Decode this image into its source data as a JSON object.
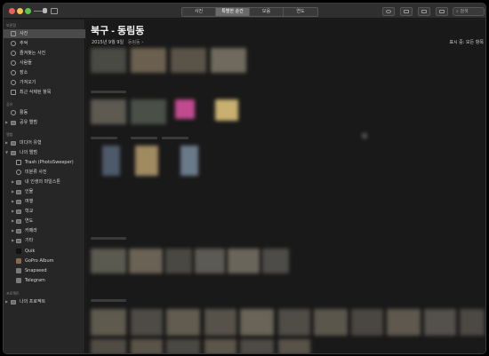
{
  "toolbar": {
    "tabs": [
      {
        "label": "사진"
      },
      {
        "label": "특별한 순간"
      },
      {
        "label": "모음"
      },
      {
        "label": "연도"
      }
    ],
    "active_tab": 1,
    "search_label": "검색"
  },
  "sidebar": {
    "library_label": "보관함",
    "shared_label": "공유",
    "albums_label": "앨범",
    "projects_label": "프로젝트",
    "library_items": [
      {
        "label": "사진"
      },
      {
        "label": "추억"
      },
      {
        "label": "즐겨찾는 사진"
      },
      {
        "label": "사람들"
      },
      {
        "label": "장소"
      },
      {
        "label": "가져오기"
      },
      {
        "label": "최근 삭제된 항목"
      }
    ],
    "shared_items": [
      {
        "label": "활동"
      },
      {
        "label": "공유 앨범"
      }
    ],
    "album_items": [
      {
        "label": "미디어 유형"
      },
      {
        "label": "나의 앨범"
      },
      {
        "label": "Trash (PhotoSweeper)"
      },
      {
        "label": "미분류 사진"
      },
      {
        "label": "내 인생의 마일스톤"
      },
      {
        "label": "인물"
      },
      {
        "label": "여행"
      },
      {
        "label": "학교"
      },
      {
        "label": "연도"
      },
      {
        "label": "카메라"
      },
      {
        "label": "기타"
      },
      {
        "label": "Quik"
      },
      {
        "label": "GoPro Album"
      },
      {
        "label": "Snapseed"
      },
      {
        "label": "Telegram"
      }
    ],
    "project_items": [
      {
        "label": "나의 프로젝트"
      }
    ]
  },
  "content": {
    "title": "북구 - 동림동",
    "date": "2015년 9월 9일",
    "place": "동림동",
    "showing_label": "표시 중: 모든 항목"
  }
}
